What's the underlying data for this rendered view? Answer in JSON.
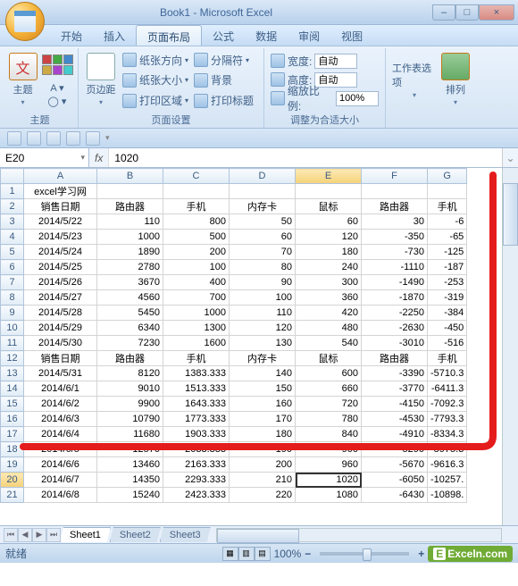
{
  "window": {
    "title": "Book1 - Microsoft Excel"
  },
  "menu": {
    "tabs": [
      "开始",
      "插入",
      "页面布局",
      "公式",
      "数据",
      "审阅",
      "视图"
    ],
    "active": 2
  },
  "ribbon": {
    "group1": {
      "theme": "主题",
      "label": "主题"
    },
    "group2": {
      "margins": "页边距",
      "orient": "纸张方向",
      "size": "纸张大小",
      "area": "打印区域",
      "breaks": "分隔符",
      "bg": "背景",
      "titles": "打印标题",
      "label": "页面设置"
    },
    "group3": {
      "width": "宽度:",
      "height": "高度:",
      "scale": "缩放比例:",
      "auto": "自动",
      "scale_val": "100%",
      "label": "调整为合适大小"
    },
    "group4": {
      "sheet_opts": "工作表选项",
      "arrange": "排列"
    }
  },
  "namebox": "E20",
  "formula": "1020",
  "fx": "fx",
  "cols": [
    "A",
    "B",
    "C",
    "D",
    "E",
    "F",
    "G"
  ],
  "rows": [
    {
      "n": "1",
      "c": [
        "excel学习网",
        "",
        "",
        "",
        "",
        "",
        ""
      ]
    },
    {
      "n": "2",
      "c": [
        "销售日期",
        "路由器",
        "手机",
        "内存卡",
        "鼠标",
        "路由器",
        "手机"
      ]
    },
    {
      "n": "3",
      "c": [
        "2014/5/22",
        "110",
        "800",
        "50",
        "60",
        "30",
        "-6"
      ]
    },
    {
      "n": "4",
      "c": [
        "2014/5/23",
        "1000",
        "500",
        "60",
        "120",
        "-350",
        "-65"
      ]
    },
    {
      "n": "5",
      "c": [
        "2014/5/24",
        "1890",
        "200",
        "70",
        "180",
        "-730",
        "-125"
      ]
    },
    {
      "n": "6",
      "c": [
        "2014/5/25",
        "2780",
        "100",
        "80",
        "240",
        "-1110",
        "-187"
      ]
    },
    {
      "n": "7",
      "c": [
        "2014/5/26",
        "3670",
        "400",
        "90",
        "300",
        "-1490",
        "-253"
      ]
    },
    {
      "n": "8",
      "c": [
        "2014/5/27",
        "4560",
        "700",
        "100",
        "360",
        "-1870",
        "-319"
      ]
    },
    {
      "n": "9",
      "c": [
        "2014/5/28",
        "5450",
        "1000",
        "110",
        "420",
        "-2250",
        "-384"
      ]
    },
    {
      "n": "10",
      "c": [
        "2014/5/29",
        "6340",
        "1300",
        "120",
        "480",
        "-2630",
        "-450"
      ]
    },
    {
      "n": "11",
      "c": [
        "2014/5/30",
        "7230",
        "1600",
        "130",
        "540",
        "-3010",
        "-516"
      ]
    },
    {
      "n": "12",
      "c": [
        "销售日期",
        "路由器",
        "手机",
        "内存卡",
        "鼠标",
        "路由器",
        "手机"
      ]
    },
    {
      "n": "13",
      "c": [
        "2014/5/31",
        "8120",
        "1383.333",
        "140",
        "600",
        "-3390",
        "-5710.3"
      ]
    },
    {
      "n": "14",
      "c": [
        "2014/6/1",
        "9010",
        "1513.333",
        "150",
        "660",
        "-3770",
        "-6411.3"
      ]
    },
    {
      "n": "15",
      "c": [
        "2014/6/2",
        "9900",
        "1643.333",
        "160",
        "720",
        "-4150",
        "-7092.3"
      ]
    },
    {
      "n": "16",
      "c": [
        "2014/6/3",
        "10790",
        "1773.333",
        "170",
        "780",
        "-4530",
        "-7793.3"
      ]
    },
    {
      "n": "17",
      "c": [
        "2014/6/4",
        "11680",
        "1903.333",
        "180",
        "840",
        "-4910",
        "-8334.3"
      ]
    },
    {
      "n": "18",
      "c": [
        "2014/6/5",
        "12570",
        "2033.333",
        "190",
        "900",
        "-5290",
        "-8975.3"
      ]
    },
    {
      "n": "19",
      "c": [
        "2014/6/6",
        "13460",
        "2163.333",
        "200",
        "960",
        "-5670",
        "-9616.3"
      ]
    },
    {
      "n": "20",
      "c": [
        "2014/6/7",
        "14350",
        "2293.333",
        "210",
        "1020",
        "-6050",
        "-10257."
      ]
    },
    {
      "n": "21",
      "c": [
        "2014/6/8",
        "15240",
        "2423.333",
        "220",
        "1080",
        "-6430",
        "-10898."
      ]
    }
  ],
  "sheets": [
    "Sheet1",
    "Sheet2",
    "Sheet3"
  ],
  "status": {
    "ready": "就绪",
    "zoom": "100%",
    "minus": "−",
    "plus": "+"
  },
  "logo": "Exceln.com"
}
